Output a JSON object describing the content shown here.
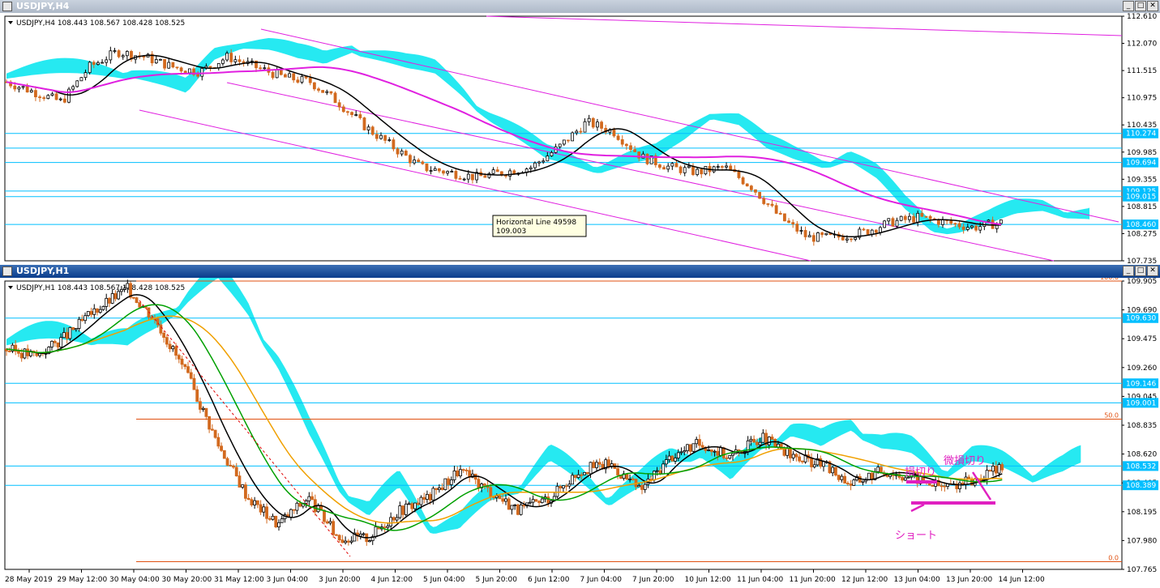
{
  "windows": [
    {
      "title": "USDJPY,H4",
      "info": "USDJPY,H4  108.443 108.567 108.428 108.525",
      "active": false,
      "price_axis": [
        "112.610",
        "112.070",
        "111.515",
        "110.975",
        "110.435",
        "109.985",
        "109.355",
        "108.815",
        "108.275",
        "107.735"
      ],
      "price_min": 107.735,
      "price_max": 112.61,
      "hlines": [
        110.274,
        109.98,
        109.694,
        109.125,
        109.015,
        108.46
      ],
      "price_tags": [
        {
          "label": "110.274",
          "price": 110.274,
          "color": "#00bfff"
        },
        {
          "label": "109.694",
          "price": 109.694,
          "color": "#00bfff"
        },
        {
          "label": "109.125",
          "price": 109.125,
          "color": "#00bfff"
        },
        {
          "label": "109.015",
          "price": 109.015,
          "color": "#00bfff"
        },
        {
          "label": "108.460",
          "price": 108.46,
          "color": "#00bfff"
        }
      ],
      "tooltip": {
        "line1": "Horizontal Line 49598",
        "line2": "109.003"
      }
    },
    {
      "title": "USDJPY,H1",
      "info": "USDJPY,H1  108.443 108.567 108.428 108.525",
      "active": true,
      "price_axis": [
        "109.905",
        "109.690",
        "109.475",
        "109.260",
        "109.045",
        "108.835",
        "108.620",
        "108.405",
        "108.195",
        "107.980",
        "107.765"
      ],
      "price_min": 107.765,
      "price_max": 109.905,
      "hlines": [
        109.63,
        109.146,
        109.001,
        108.532,
        108.389
      ],
      "price_tags": [
        {
          "label": "109.630",
          "price": 109.63,
          "color": "#00bfff"
        },
        {
          "label": "109.146",
          "price": 109.146,
          "color": "#00bfff"
        },
        {
          "label": "109.001",
          "price": 109.001,
          "color": "#00bfff"
        },
        {
          "label": "108.532",
          "price": 108.532,
          "color": "#00bfff"
        },
        {
          "label": "108.389",
          "price": 108.389,
          "color": "#00bfff"
        }
      ],
      "fib_levels": [
        {
          "label": "100.0",
          "price": 109.905
        },
        {
          "label": "50.0",
          "price": 108.88
        },
        {
          "label": "0.0",
          "price": 107.822
        }
      ],
      "time_axis": [
        "28 May 2019",
        "29 May 12:00",
        "30 May 04:00",
        "30 May 20:00",
        "31 May 12:00",
        "3 Jun 04:00",
        "3 Jun 20:00",
        "4 Jun 12:00",
        "5 Jun 04:00",
        "5 Jun 20:00",
        "6 Jun 12:00",
        "7 Jun 04:00",
        "7 Jun 20:00",
        "10 Jun 12:00",
        "11 Jun 04:00",
        "11 Jun 20:00",
        "12 Jun 12:00",
        "13 Jun 04:00",
        "13 Jun 20:00",
        "14 Jun 12:00"
      ],
      "annotations": {
        "stop_loss": "損切り",
        "small_stop_loss": "微損切り",
        "short": "ショート"
      }
    }
  ],
  "colors": {
    "bull_candle": "#000000",
    "bear_candle": "#d2691e",
    "cloud_a": "#00e5ee",
    "cloud_b": "#a9a9a9",
    "channel": "#e020e0",
    "hline": "#00bfff",
    "fib": "#e05010",
    "ma_black": "#000000",
    "ma_orange": "#f0a000",
    "ma_green": "#00a000"
  },
  "chart_data": [
    {
      "type": "line",
      "title": "USDJPY,H4",
      "ylim": [
        107.735,
        112.61
      ],
      "series": [
        {
          "name": "USDJPY",
          "values": [
            111.3,
            111.1,
            110.9,
            111.6,
            111.9,
            111.8,
            111.6,
            111.5,
            111.8,
            111.6,
            111.4,
            111.3,
            110.9,
            110.4,
            110.0,
            109.6,
            109.5,
            109.4,
            109.5,
            109.6,
            110.0,
            110.5,
            110.3,
            109.8,
            109.6,
            109.5,
            109.6,
            109.2,
            108.6,
            108.2,
            108.2,
            108.3,
            108.5,
            108.6,
            108.5,
            108.4,
            108.5
          ]
        }
      ]
    },
    {
      "type": "line",
      "title": "USDJPY,H1",
      "ylim": [
        107.765,
        109.905
      ],
      "series": [
        {
          "name": "USDJPY",
          "values": [
            109.4,
            109.35,
            109.5,
            109.7,
            109.85,
            109.6,
            109.2,
            108.7,
            108.3,
            108.1,
            108.3,
            108.0,
            108.0,
            108.2,
            108.3,
            108.5,
            108.35,
            108.2,
            108.3,
            108.5,
            108.55,
            108.35,
            108.6,
            108.7,
            108.6,
            108.75,
            108.6,
            108.55,
            108.4,
            108.5,
            108.45,
            108.38,
            108.42,
            108.52
          ]
        }
      ]
    }
  ]
}
